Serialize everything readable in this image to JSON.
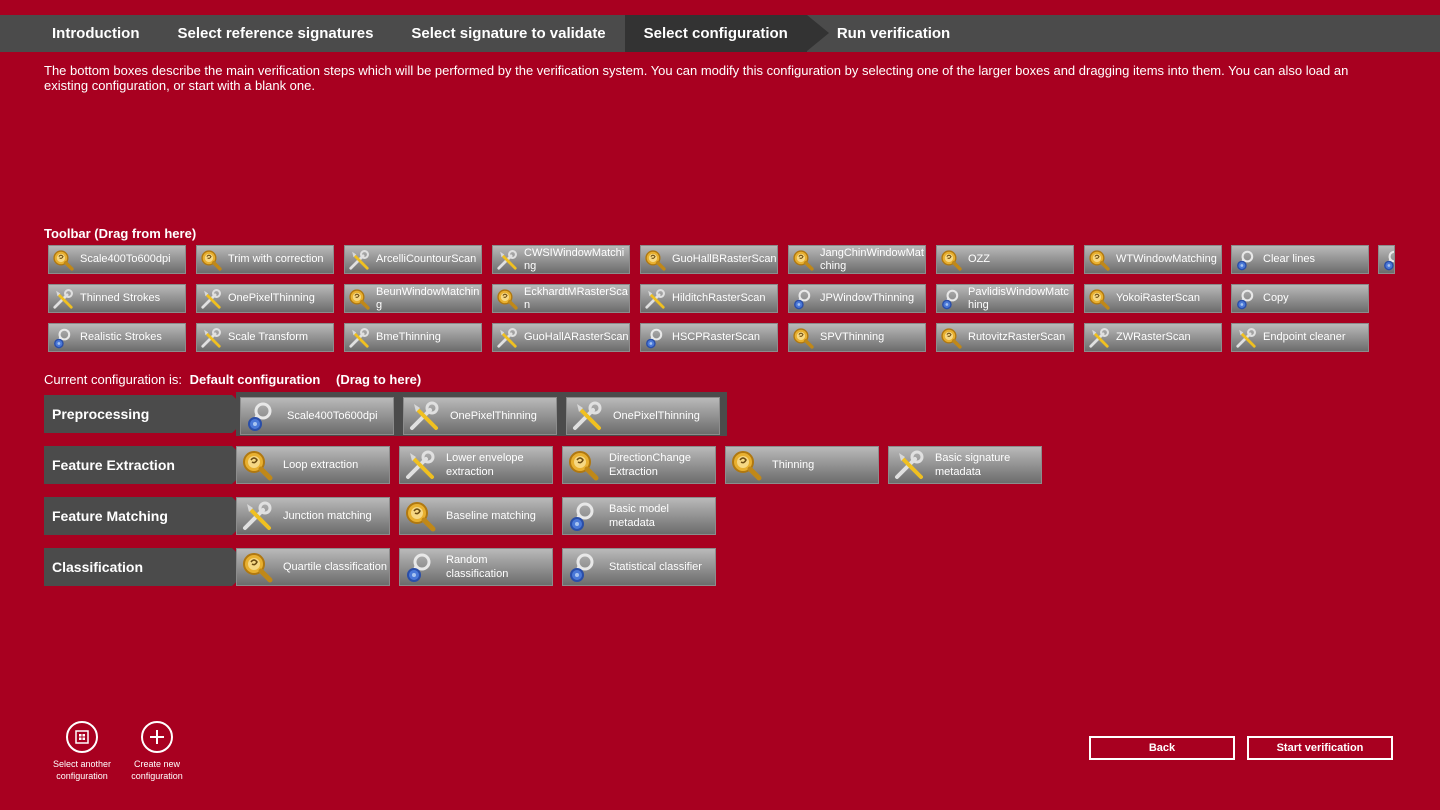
{
  "nav": {
    "steps": [
      "Introduction",
      "Select reference signatures",
      "Select signature to validate",
      "Select configuration",
      "Run verification"
    ],
    "active_step": "Select configuration"
  },
  "intro_text": "The bottom boxes describe the main verification steps which will be performed by the verification system. You can modify this configuration by selecting one of the larger boxes and dragging items into them. You can also load an existing configuration, or start with a blank one.",
  "toolbar": {
    "title": "Toolbar (Drag from here)",
    "rows": [
      [
        {
          "label": "Scale400To600dpi",
          "icon": "magnifier-icon"
        },
        {
          "label": "Trim with correction",
          "icon": "magnifier-icon"
        },
        {
          "label": "ArcelliCountourScan",
          "icon": "tools-icon"
        },
        {
          "label": "CWSIWindowMatching",
          "icon": "tools-icon"
        },
        {
          "label": "GuoHallBRasterScan",
          "icon": "magnifier-icon"
        },
        {
          "label": "JangChinWindowMatching",
          "icon": "magnifier-icon"
        },
        {
          "label": "OZZ",
          "icon": "magnifier-icon"
        },
        {
          "label": "WTWindowMatching",
          "icon": "magnifier-icon"
        },
        {
          "label": "Clear lines",
          "icon": "gear-icon"
        },
        {
          "label": "",
          "icon": "gear-icon"
        }
      ],
      [
        {
          "label": "Thinned Strokes",
          "icon": "tools-icon"
        },
        {
          "label": "OnePixelThinning",
          "icon": "tools-icon"
        },
        {
          "label": "BeunWindowMatching",
          "icon": "magnifier-icon"
        },
        {
          "label": "EckhardtMRasterScan",
          "icon": "magnifier-icon"
        },
        {
          "label": "HilditchRasterScan",
          "icon": "tools-icon"
        },
        {
          "label": "JPWindowThinning",
          "icon": "gear-icon"
        },
        {
          "label": "PavlidisWindowMatching",
          "icon": "gear-icon"
        },
        {
          "label": "YokoiRasterScan",
          "icon": "magnifier-icon"
        },
        {
          "label": "Copy",
          "icon": "gear-icon"
        }
      ],
      [
        {
          "label": "Realistic Strokes",
          "icon": "gear-icon"
        },
        {
          "label": "Scale Transform",
          "icon": "tools-icon"
        },
        {
          "label": "BmeThinning",
          "icon": "tools-icon"
        },
        {
          "label": "GuoHallARasterScan",
          "icon": "tools-icon"
        },
        {
          "label": "HSCPRasterScan",
          "icon": "gear-icon"
        },
        {
          "label": "SPVThinning",
          "icon": "magnifier-icon"
        },
        {
          "label": "RutovitzRasterScan",
          "icon": "magnifier-icon"
        },
        {
          "label": "ZWRasterScan",
          "icon": "tools-icon"
        },
        {
          "label": "Endpoint cleaner",
          "icon": "tools-icon"
        }
      ]
    ]
  },
  "config": {
    "prefix": "Current configuration is:",
    "name": "Default configuration",
    "hint": "(Drag to here)"
  },
  "stages": [
    {
      "name": "Preprocessing",
      "items": [
        {
          "label": "Scale400To600dpi",
          "icon": "gear-icon"
        },
        {
          "label": "OnePixelThinning",
          "icon": "tools-icon"
        },
        {
          "label": "OnePixelThinning",
          "icon": "tools-icon"
        }
      ]
    },
    {
      "name": "Feature Extraction",
      "items": [
        {
          "label": "Loop extraction",
          "icon": "magnifier-icon"
        },
        {
          "label": "Lower envelope extraction",
          "icon": "tools-icon"
        },
        {
          "label": "DirectionChange Extraction",
          "icon": "magnifier-icon"
        },
        {
          "label": "Thinning",
          "icon": "magnifier-icon"
        },
        {
          "label": "Basic signature metadata",
          "icon": "tools-icon"
        }
      ]
    },
    {
      "name": "Feature Matching",
      "items": [
        {
          "label": "Junction matching",
          "icon": "tools-icon"
        },
        {
          "label": "Baseline matching",
          "icon": "magnifier-icon"
        },
        {
          "label": "Basic model metadata",
          "icon": "gear-icon"
        }
      ]
    },
    {
      "name": "Classification",
      "items": [
        {
          "label": "Quartile classification",
          "icon": "magnifier-icon"
        },
        {
          "label": "Random classification",
          "icon": "gear-icon"
        },
        {
          "label": "Statistical classifier",
          "icon": "gear-icon"
        }
      ]
    }
  ],
  "appbar": {
    "select_another": "Select another configuration",
    "create_new": "Create new configuration"
  },
  "buttons": {
    "back": "Back",
    "start": "Start verification"
  },
  "colors": {
    "background": "#a80020",
    "nav_bar": "#4b4b4b",
    "nav_active": "#333333"
  }
}
